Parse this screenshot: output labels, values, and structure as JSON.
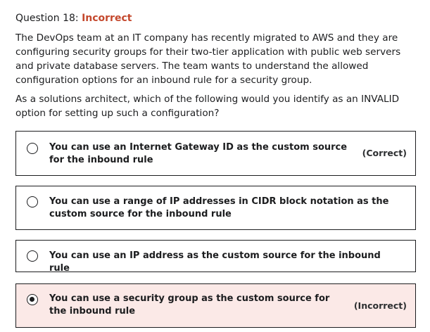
{
  "header": {
    "question_label": "Question 18:",
    "status": "Incorrect"
  },
  "question": {
    "paragraph1": "The DevOps team at an IT company has recently migrated to AWS and they are configuring security groups for their two-tier application with public web servers and private database servers. The team wants to understand the allowed configuration options for an inbound rule for a security group.",
    "paragraph2": "As a solutions architect, which of the following would you identify as an INVALID option for setting up such a configuration?"
  },
  "options": [
    {
      "text": "You can use an Internet Gateway ID as the custom source for the inbound rule",
      "verdict": "(Correct)",
      "selected": false
    },
    {
      "text": "You can use a range of IP addresses in CIDR block notation as the custom source for the inbound rule",
      "verdict": "",
      "selected": false
    },
    {
      "text": "You can use an IP address as the custom source for the inbound rule",
      "verdict": "",
      "selected": false
    },
    {
      "text": "You can use a security group as the custom source for the inbound rule",
      "verdict": "(Incorrect)",
      "selected": true
    }
  ],
  "colors": {
    "incorrect_text": "#c4482d",
    "incorrect_choice_background": "#fbe9e7",
    "border": "#1c1d1f"
  }
}
